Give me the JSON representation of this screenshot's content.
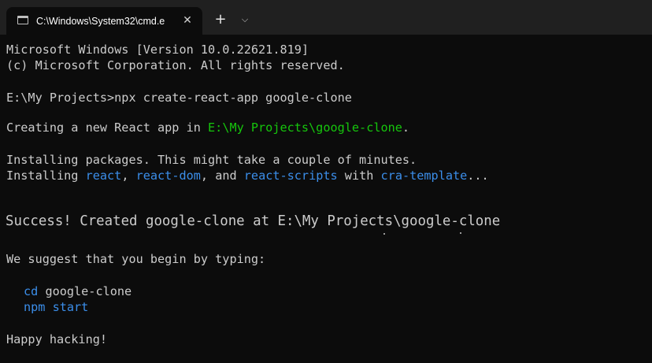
{
  "tab": {
    "title": "C:\\Windows\\System32\\cmd.e",
    "close": "✕",
    "new_tab": "+",
    "dropdown": "⌵"
  },
  "console": {
    "header1": "Microsoft Windows [Version 10.0.22621.819]",
    "header2": "(c) Microsoft Corporation. All rights reserved.",
    "prompt": "E:\\My Projects>npx create-react-app google-clone",
    "creating_prefix": "Creating a new React app in ",
    "creating_path": "E:\\My Projects\\google-clone",
    "creating_suffix": ".",
    "installing1": "Installing packages. This might take a couple of minutes.",
    "installing2_prefix": "Installing ",
    "pkg_react": "react",
    "sep1": ", ",
    "pkg_react_dom": "react-dom",
    "sep2": ", and ",
    "pkg_react_scripts": "react-scripts",
    "with": " with ",
    "pkg_template": "cra-template",
    "ellipsis": "...",
    "success": "Success! Created google-clone at E:\\My Projects\\google-clone",
    "suggest": "We suggest that you begin by typing:",
    "cmd_cd": "cd",
    "cd_arg": " google-clone",
    "cmd_npm_start": "npm start",
    "happy": "Happy hacking!"
  },
  "colors": {
    "background": "#0c0c0c",
    "titlebar": "#202020",
    "text": "#cccccc",
    "path_green": "#16c60c",
    "package_blue": "#3b8eea"
  }
}
